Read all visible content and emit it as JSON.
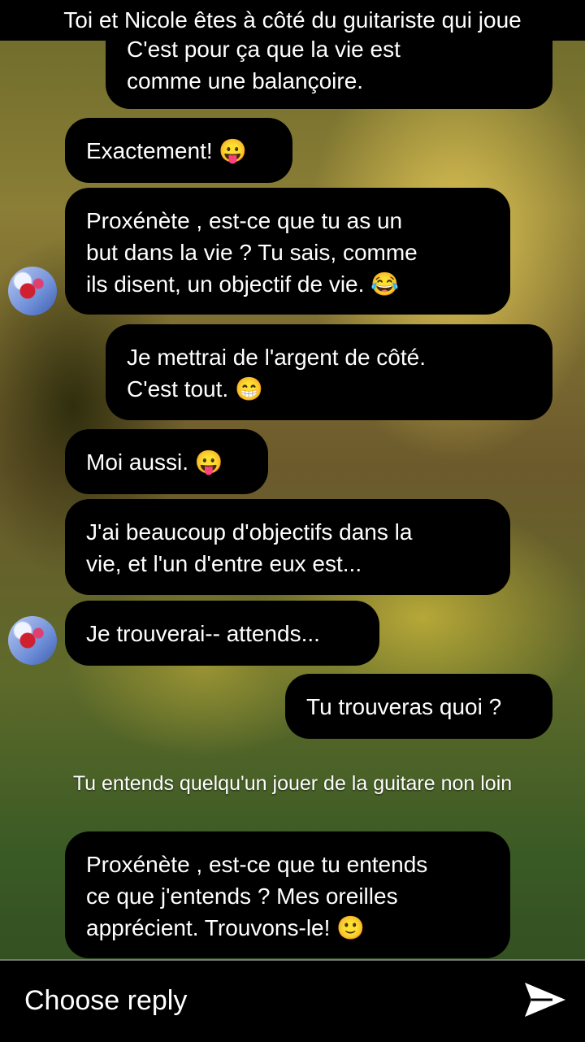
{
  "header": {
    "title": "Toi et Nicole êtes à côté du guitariste qui joue"
  },
  "messages": [
    {
      "side": "right",
      "text": "C'est pour ça que la vie est\ncomme une balançoire."
    },
    {
      "side": "left",
      "text": "Exactement! 😛"
    },
    {
      "side": "left",
      "text": "Proxénète , est-ce que tu as un\nbut dans la vie ? Tu sais, comme\nils disent, un objectif de vie. 😂"
    },
    {
      "side": "right",
      "text": "Je mettrai de l'argent de côté.\nC'est tout. 😁"
    },
    {
      "side": "left",
      "text": "Moi aussi. 😛"
    },
    {
      "side": "left",
      "text": "J'ai beaucoup d'objectifs dans la\nvie, et l'un d'entre eux est..."
    },
    {
      "side": "left",
      "text": "Je trouverai-- attends..."
    },
    {
      "side": "right",
      "text": "Tu trouveras quoi ?"
    },
    {
      "side": "left",
      "text": "Proxénète , est-ce que tu entends\nce que j'entends ? Mes oreilles\napprécient. Trouvons-le! 🙂"
    }
  ],
  "narration": "Tu entends quelqu'un jouer de la guitare non loin",
  "composer": {
    "label": "Choose reply",
    "send_icon": "send-icon"
  }
}
